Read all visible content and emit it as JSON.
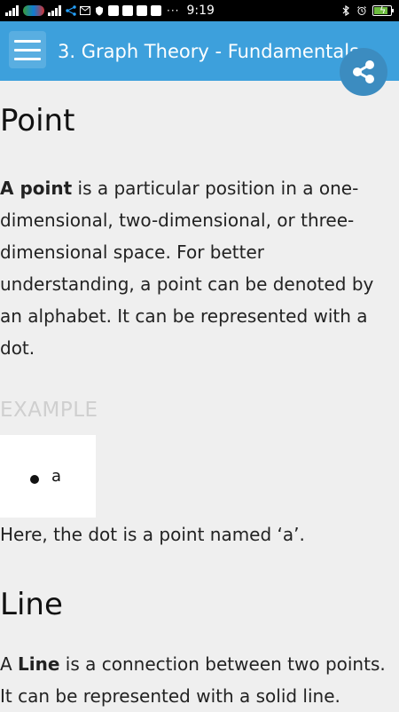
{
  "status_bar": {
    "time": "9:19",
    "more_indicator": "···",
    "battery_level": 0.82
  },
  "app_bar": {
    "title": "3. Graph Theory - Fundamentals",
    "menu_icon": "menu-icon",
    "share_icon": "share-icon"
  },
  "content": {
    "point_title": "Point",
    "point_bold": "A point",
    "point_text": " is a particular position in a one-dimensional, two-dimensional, or three-dimensional space. For better understanding, a point can be denoted by an alphabet. It can be represented with a dot.",
    "example_heading": "EXAMPLE",
    "example_label": "a",
    "example_caption": "Here, the dot is a point named ‘a’.",
    "line_title": "Line",
    "line_prefix": "A ",
    "line_bold": "Line",
    "line_text": " is a connection between two points. It can be represented with a solid line."
  }
}
